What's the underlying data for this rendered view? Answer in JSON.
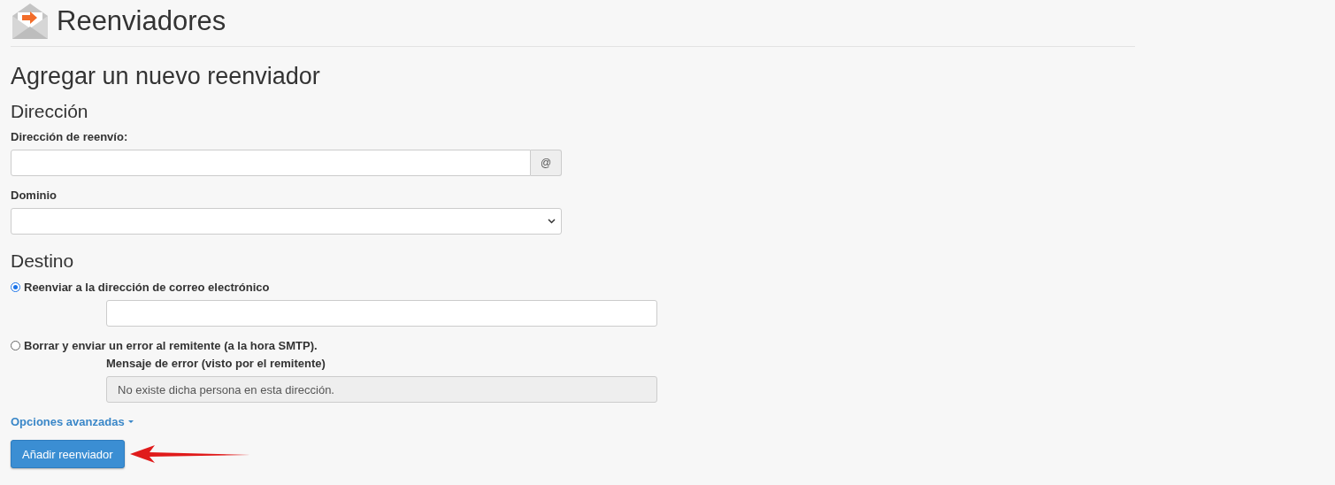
{
  "page_title": "Reenviadores",
  "form_title": "Agregar un nuevo reenviador",
  "address_section": {
    "heading": "Dirección",
    "forward_label": "Dirección de reenvío:",
    "at_sign": "@",
    "domain_label": "Dominio"
  },
  "destination_section": {
    "heading": "Destino",
    "options": [
      {
        "kind": "email",
        "label": "Reenviar a la dirección de correo electrónico",
        "selected": true
      },
      {
        "kind": "error",
        "label": "Borrar y enviar un error al remitente (a la hora SMTP).",
        "selected": false,
        "field_label": "Mensaje de error (visto por el remitente)",
        "field_value": "No existe dicha persona en esta dirección.",
        "disabled": true
      }
    ]
  },
  "advanced_link": "Opciones avanzadas",
  "submit_button": "Añadir reenviador"
}
